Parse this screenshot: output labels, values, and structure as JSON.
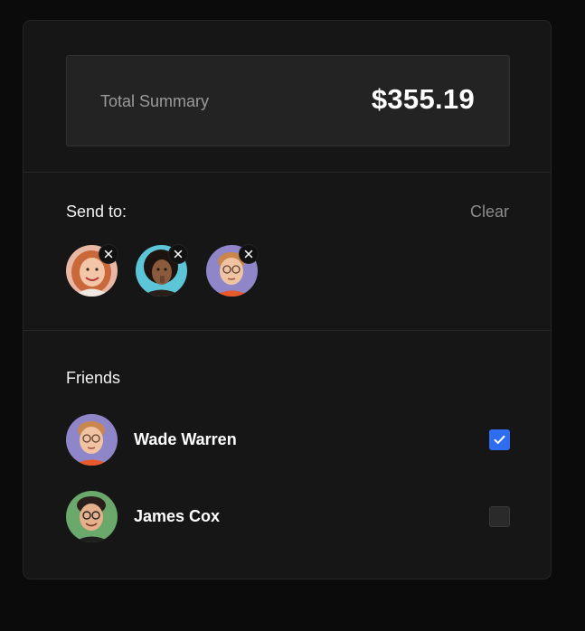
{
  "summary": {
    "label": "Total Summary",
    "amount": "$355.19"
  },
  "send_to": {
    "label": "Send to:",
    "clear_label": "Clear",
    "recipients": [
      {
        "avatar_icon": "avatar-woman-red-hair",
        "bg": "#e9b8a4"
      },
      {
        "avatar_icon": "avatar-woman-curly-hair",
        "bg": "#5cc6d8"
      },
      {
        "avatar_icon": "avatar-man-glasses",
        "bg": "#8f86c9"
      }
    ]
  },
  "friends": {
    "label": "Friends",
    "items": [
      {
        "name": "Wade Warren",
        "checked": true,
        "avatar_bg": "#8f86c9"
      },
      {
        "name": "James Cox",
        "checked": false,
        "avatar_bg": "#6aa86b"
      }
    ]
  },
  "colors": {
    "accent": "#2f6df0",
    "card_bg": "#161616",
    "page_bg": "#0b0b0b"
  }
}
